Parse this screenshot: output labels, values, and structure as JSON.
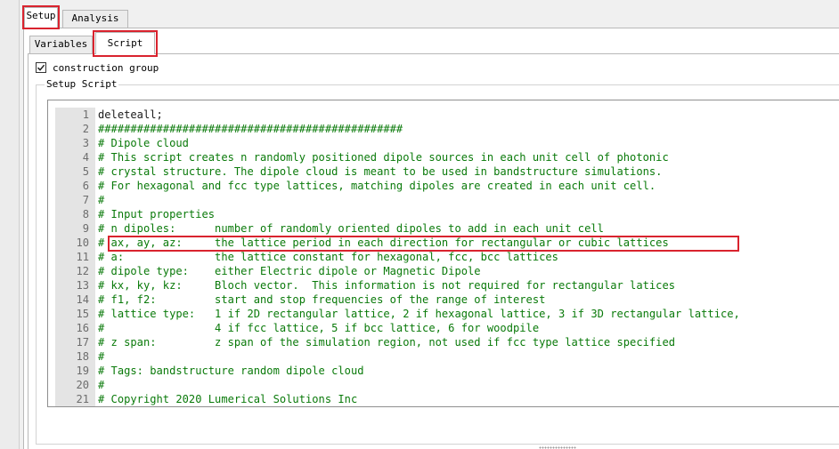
{
  "main_tabs": [
    {
      "label": "Setup",
      "active": true
    },
    {
      "label": "Analysis",
      "active": false
    }
  ],
  "sub_tabs": [
    {
      "label": "Variables",
      "active": false
    },
    {
      "label": "Script",
      "active": true
    }
  ],
  "construction_group": {
    "label": "construction group",
    "checked": true
  },
  "setup_script": {
    "legend": "Setup Script",
    "lines": [
      {
        "n": "1",
        "text": "deleteall;"
      },
      {
        "n": "2",
        "text": "###############################################"
      },
      {
        "n": "3",
        "text": "# Dipole cloud"
      },
      {
        "n": "4",
        "text": "# This script creates n randomly positioned dipole sources in each unit cell of photonic"
      },
      {
        "n": "5",
        "text": "# crystal structure. The dipole cloud is meant to be used in bandstructure simulations."
      },
      {
        "n": "6",
        "text": "# For hexagonal and fcc type lattices, matching dipoles are created in each unit cell."
      },
      {
        "n": "7",
        "text": "#"
      },
      {
        "n": "8",
        "text": "# Input properties"
      },
      {
        "n": "9",
        "text": "# n dipoles:      number of randomly oriented dipoles to add in each unit cell"
      },
      {
        "n": "10",
        "text": "# ax, ay, az:     the lattice period in each direction for rectangular or cubic lattices"
      },
      {
        "n": "11",
        "text": "# a:              the lattice constant for hexagonal, fcc, bcc lattices"
      },
      {
        "n": "12",
        "text": "# dipole type:    either Electric dipole or Magnetic Dipole"
      },
      {
        "n": "13",
        "text": "# kx, ky, kz:     Bloch vector.  This information is not required for rectangular latices"
      },
      {
        "n": "14",
        "text": "# f1, f2:         start and stop frequencies of the range of interest"
      },
      {
        "n": "15",
        "text": "# lattice type:   1 if 2D rectangular lattice, 2 if hexagonal lattice, 3 if 3D rectangular lattice,"
      },
      {
        "n": "16",
        "text": "#                 4 if fcc lattice, 5 if bcc lattice, 6 for woodpile"
      },
      {
        "n": "17",
        "text": "# z span:         z span of the simulation region, not used if fcc type lattice specified"
      },
      {
        "n": "18",
        "text": "#"
      },
      {
        "n": "19",
        "text": "# Tags: bandstructure random dipole cloud"
      },
      {
        "n": "20",
        "text": "#"
      },
      {
        "n": "21",
        "text": "# Copyright 2020 Lumerical Solutions Inc"
      }
    ]
  },
  "colors": {
    "highlight": "#d9232e",
    "comment": "#0a7a0a",
    "gutter": "#e4e4e4"
  }
}
